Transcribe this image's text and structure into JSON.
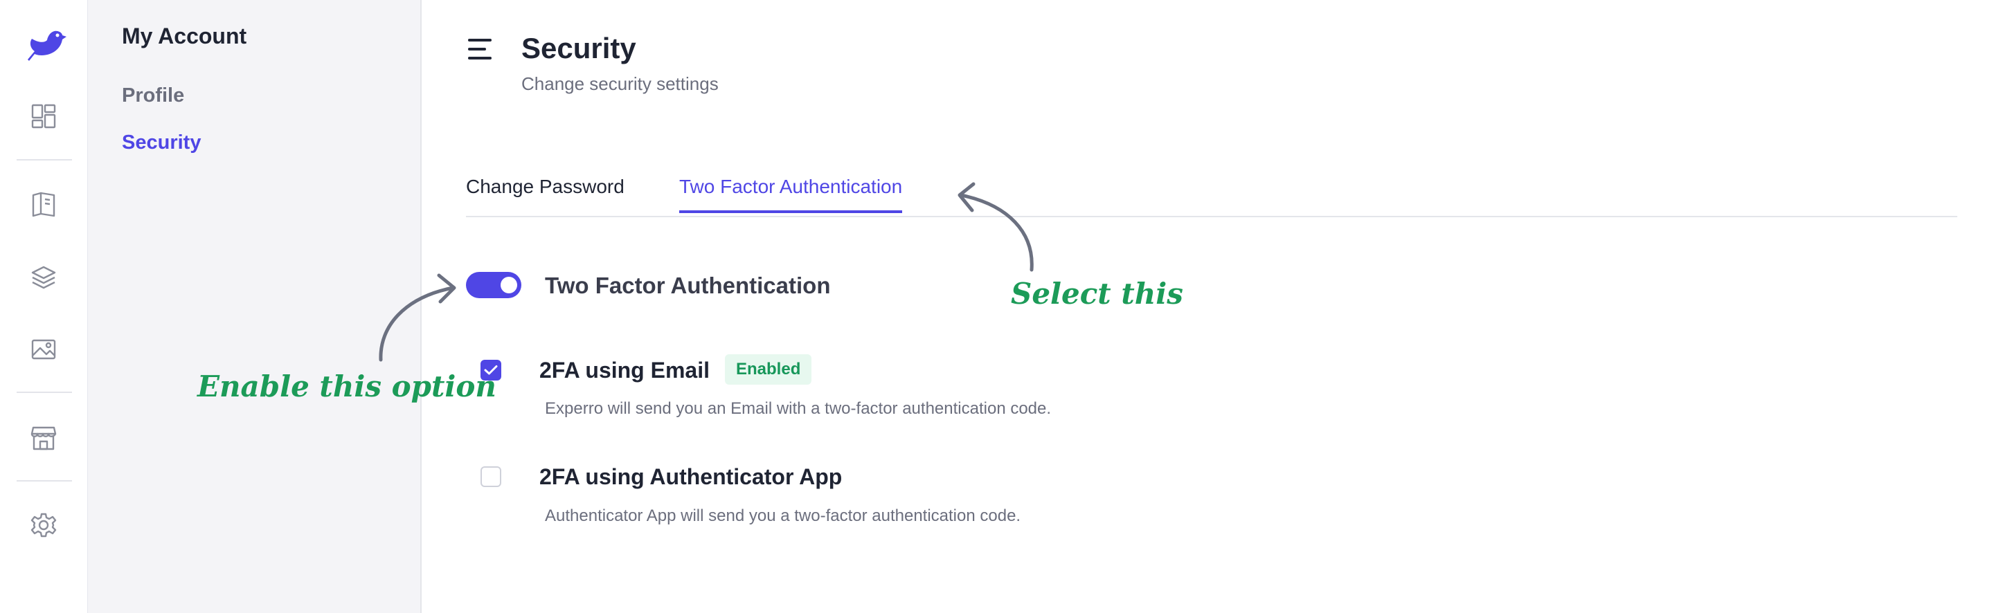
{
  "sidebar": {
    "heading": "My Account",
    "items": [
      {
        "label": "Profile",
        "active": false
      },
      {
        "label": "Security",
        "active": true
      }
    ]
  },
  "header": {
    "title": "Security",
    "subtitle": "Change security settings"
  },
  "tabs": [
    {
      "label": "Change Password",
      "active": false
    },
    {
      "label": "Two Factor Authentication",
      "active": true
    }
  ],
  "two_factor": {
    "toggle_label": "Two Factor Authentication",
    "toggle_on": true,
    "options": [
      {
        "label": "2FA using Email",
        "checked": true,
        "badge": "Enabled",
        "description": "Experro will send you an Email with a two-factor authentication code."
      },
      {
        "label": "2FA using Authenticator App",
        "checked": false,
        "description": "Authenticator App will send you a two-factor authentication code."
      }
    ]
  },
  "annotations": {
    "select": "Select this",
    "enable": "Enable this option"
  },
  "rail_icons": [
    "bird-logo-icon",
    "dashboard-icon",
    "book-icon",
    "layers-icon",
    "image-icon",
    "store-icon",
    "gear-icon"
  ],
  "colors": {
    "accent": "#4f46e5",
    "annotation": "#1c9b58",
    "badge_bg": "#e7f8ef",
    "badge_text": "#17975a"
  }
}
